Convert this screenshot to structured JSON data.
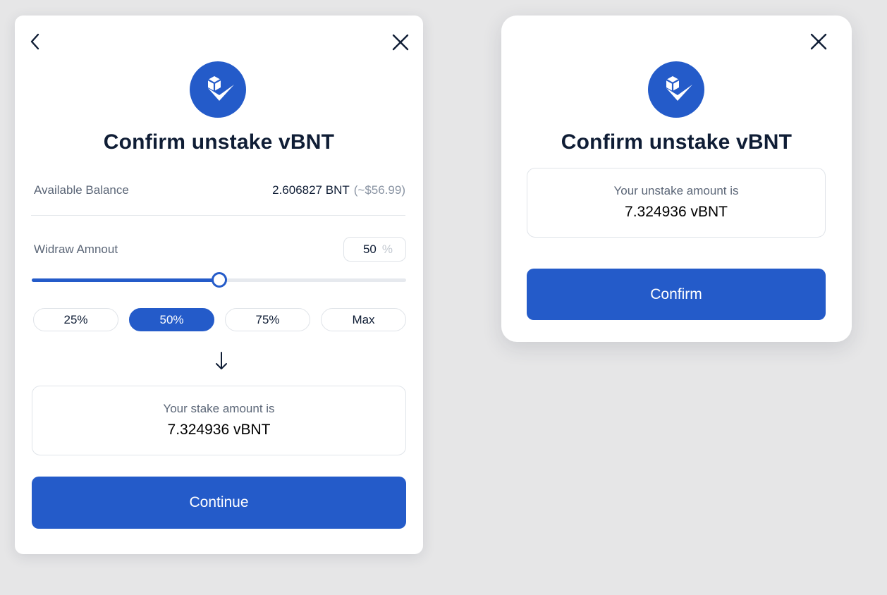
{
  "left_modal": {
    "title": "Confirm unstake vBNT",
    "balance_label": "Available Balance",
    "balance_value": "2.606827 BNT",
    "balance_usd": "(~$56.99)",
    "withdraw_label": "Widraw Amnout",
    "withdraw_percent": "50",
    "percent_symbol": "%",
    "slider_percent": 50,
    "quick_buttons": [
      "25%",
      "50%",
      "75%",
      "Max"
    ],
    "active_quick_button": "50%",
    "result_label": "Your stake amount is",
    "result_amount": "7.324936 vBNT",
    "continue_label": "Continue"
  },
  "right_modal": {
    "title": "Confirm unstake vBNT",
    "result_label": "Your unstake amount is",
    "result_amount": "7.324936 vBNT",
    "confirm_label": "Confirm"
  },
  "colors": {
    "accent": "#245bc9",
    "background": "#e6e6e7",
    "text_primary": "#0f1d35",
    "text_secondary": "#5b6677"
  },
  "icons": [
    "back-arrow-icon",
    "close-icon",
    "bancor-logo-icon",
    "arrow-down-icon"
  ]
}
